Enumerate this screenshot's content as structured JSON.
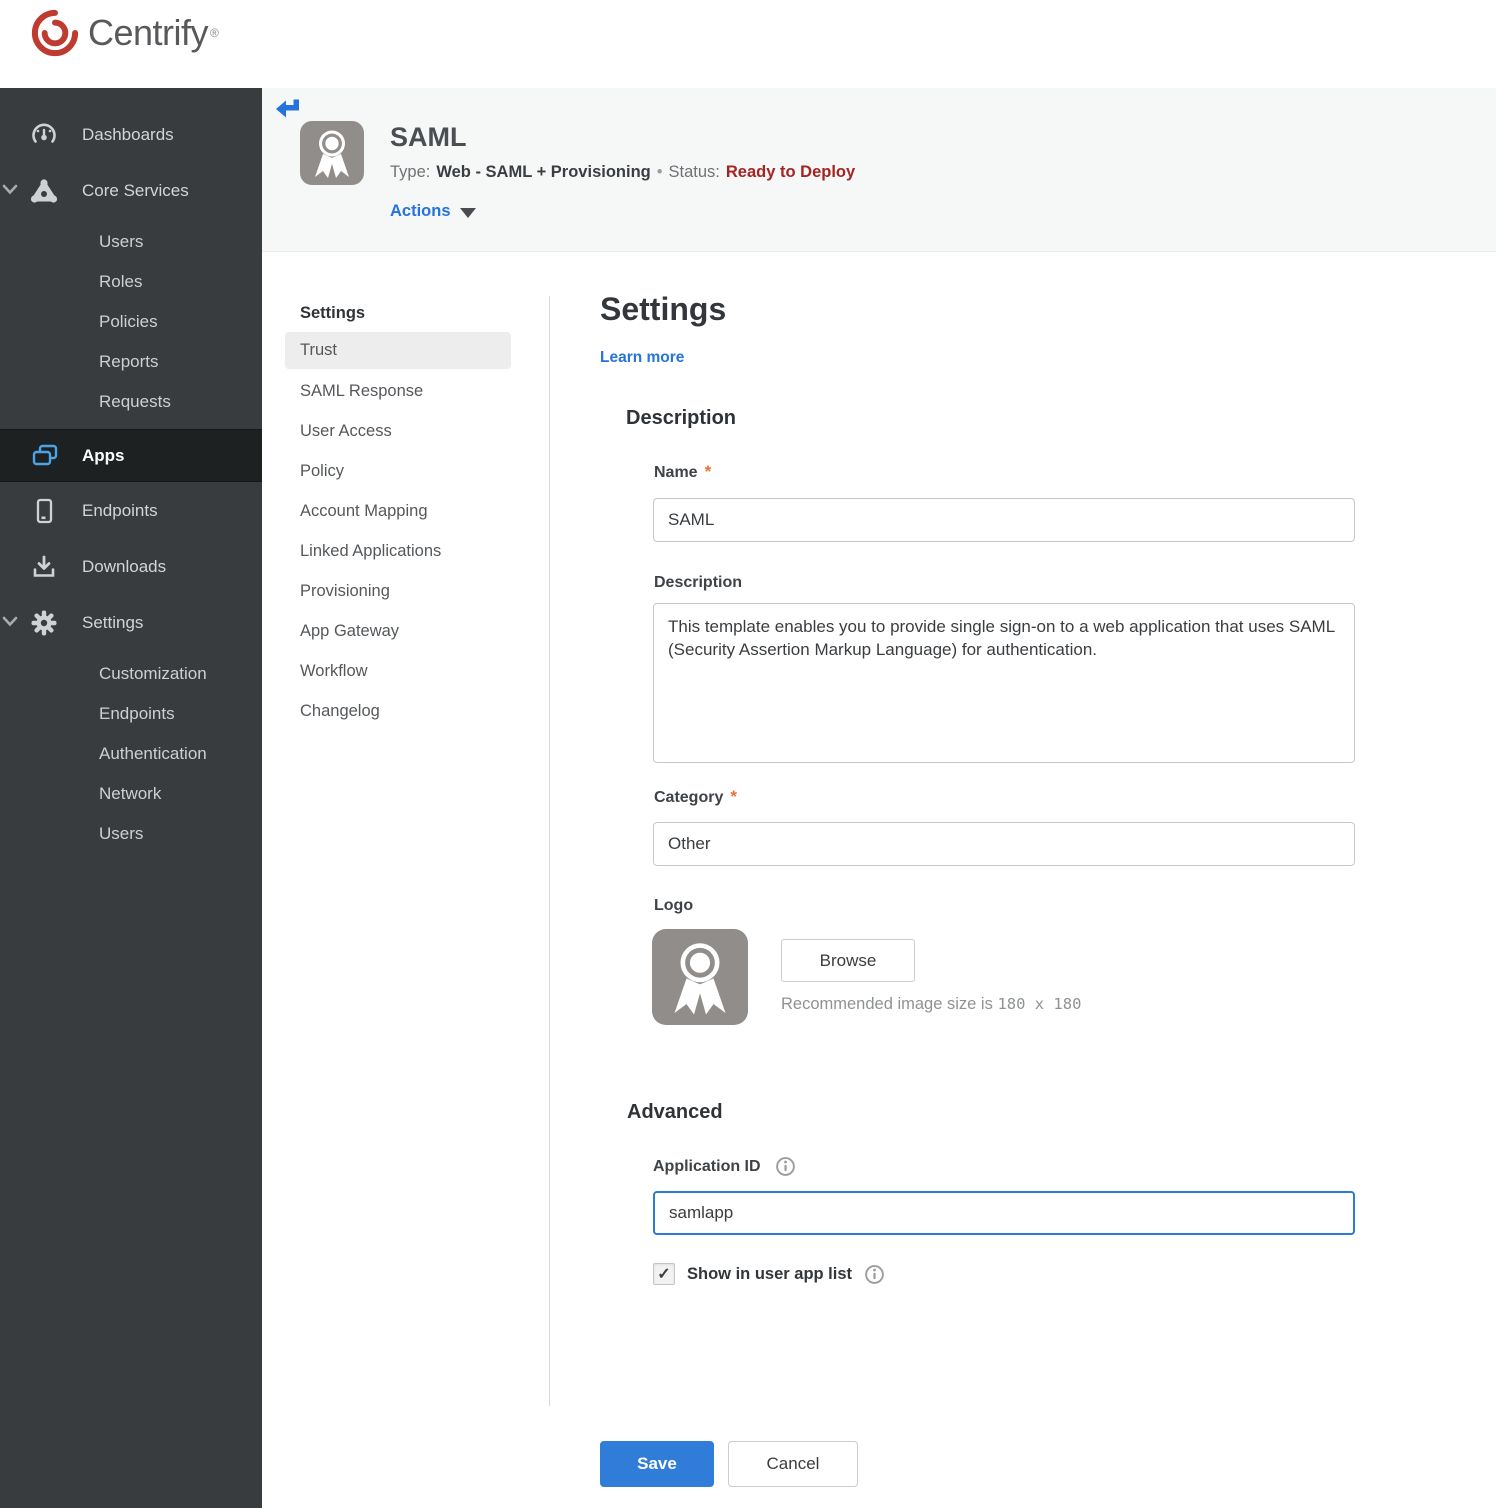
{
  "brand": {
    "name": "Centrify",
    "registered": "®"
  },
  "colors": {
    "accent_blue": "#2574db",
    "save_blue": "#2f7cd9",
    "status_red": "#a32422",
    "sidebar_bg": "#393c3e",
    "sidebar_active_bg": "#1e2122",
    "apps_icon_blue": "#4ba4e8",
    "brand_red": "#bf3b30",
    "header_band_bg": "#f6f7f7",
    "required_orange": "#e87035",
    "selected_subnav_bg": "#ededed"
  },
  "sidebar": {
    "items": [
      {
        "label": "Dashboards"
      },
      {
        "label": "Core Services",
        "expanded": true
      },
      {
        "label": "Users"
      },
      {
        "label": "Roles"
      },
      {
        "label": "Policies"
      },
      {
        "label": "Reports"
      },
      {
        "label": "Requests"
      },
      {
        "label": "Apps",
        "active": true
      },
      {
        "label": "Endpoints"
      },
      {
        "label": "Downloads"
      },
      {
        "label": "Settings",
        "expanded": true
      },
      {
        "label": "Customization"
      },
      {
        "label": "Endpoints"
      },
      {
        "label": "Authentication"
      },
      {
        "label": "Network"
      },
      {
        "label": "Users"
      }
    ]
  },
  "app_header": {
    "title": "SAML",
    "type_label": "Type:",
    "type_value": "Web - SAML + Provisioning",
    "separator": "•",
    "status_label": "Status:",
    "status_value": "Ready to Deploy",
    "actions_label": "Actions"
  },
  "subnav": {
    "header": "Settings",
    "selected": "Trust",
    "items": [
      "Trust",
      "SAML Response",
      "User Access",
      "Policy",
      "Account Mapping",
      "Linked Applications",
      "Provisioning",
      "App Gateway",
      "Workflow",
      "Changelog"
    ]
  },
  "main": {
    "title": "Settings",
    "learn_more": "Learn more",
    "required_marker": "*",
    "description_section": {
      "heading": "Description",
      "name_label": "Name",
      "name_value": "SAML",
      "description_label": "Description",
      "description_value": "This template enables you to provide single sign-on to a web application that uses SAML (Security Assertion Markup Language) for authentication.",
      "category_label": "Category",
      "category_value": "Other",
      "logo_label": "Logo",
      "browse_button": "Browse",
      "logo_hint_prefix": "Recommended image size is ",
      "logo_hint_size": "180 x 180"
    },
    "advanced_section": {
      "heading": "Advanced",
      "application_id_label": "Application ID",
      "application_id_value": "samlapp",
      "show_in_user_app_list_label": "Show in user app list",
      "checkbox_checked": true,
      "checkbox_glyph": "✓"
    },
    "footer": {
      "save_label": "Save",
      "cancel_label": "Cancel"
    }
  }
}
